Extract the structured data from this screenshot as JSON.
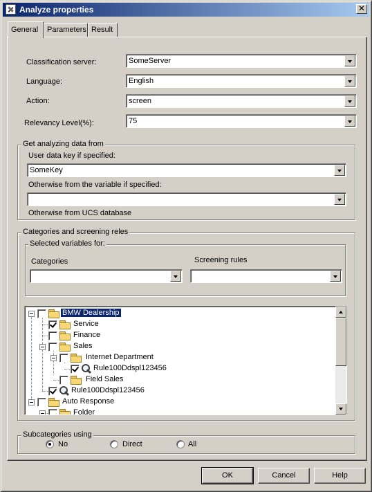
{
  "window": {
    "title": "Analyze properties",
    "close_glyph": "✕"
  },
  "tabs": [
    {
      "label": "General",
      "active": true
    },
    {
      "label": "Parameters",
      "active": false
    },
    {
      "label": "Result",
      "active": false
    }
  ],
  "form": {
    "classification_server": {
      "label": "Classification server:",
      "value": "SomeServer"
    },
    "language": {
      "label": "Language:",
      "value": "English"
    },
    "action": {
      "label": "Action:",
      "value": "screen"
    },
    "relevancy": {
      "label": "Relevancy Level(%):",
      "value": "75"
    }
  },
  "analyzing": {
    "legend": "Get analyzing data from",
    "user_key_label": "User data key if specified:",
    "user_key_value": "SomeKey",
    "variable_label": "Otherwise from the variable if specified:",
    "variable_value": "",
    "ucs_label": "Otherwise from UCS database"
  },
  "categories": {
    "legend": "Categories and screening reles",
    "selected_legend": "Selected variables for:",
    "categories_label": "Categories",
    "categories_value": "",
    "screening_label": "Screening rules",
    "screening_value": ""
  },
  "tree": [
    {
      "label": "BMW Dealership",
      "checked": false,
      "icon": "folder-icon",
      "selected": true
    },
    {
      "label": "Service",
      "checked": true,
      "icon": "folder-icon"
    },
    {
      "label": "Finance",
      "checked": false,
      "icon": "folder-icon"
    },
    {
      "label": "Sales",
      "checked": false,
      "icon": "folder-icon"
    },
    {
      "label": "Internet Department",
      "checked": false,
      "icon": "folder-icon"
    },
    {
      "label": "Rule100Ddspl123456",
      "checked": true,
      "icon": "magnifier-icon"
    },
    {
      "label": "Field Sales",
      "checked": false,
      "icon": "folder-icon"
    },
    {
      "label": "Rule100Ddspl123456",
      "checked": true,
      "icon": "magnifier-icon"
    },
    {
      "label": "Auto Response",
      "checked": false,
      "icon": "folder-icon"
    },
    {
      "label": "Folder",
      "checked": false,
      "icon": "folder-icon"
    }
  ],
  "subcategories": {
    "legend": "Subcategories using",
    "options": [
      {
        "label": "No",
        "selected": true
      },
      {
        "label": "Direct",
        "selected": false
      },
      {
        "label": "All",
        "selected": false
      }
    ]
  },
  "buttons": {
    "ok": "OK",
    "cancel": "Cancel",
    "help": "Help"
  }
}
